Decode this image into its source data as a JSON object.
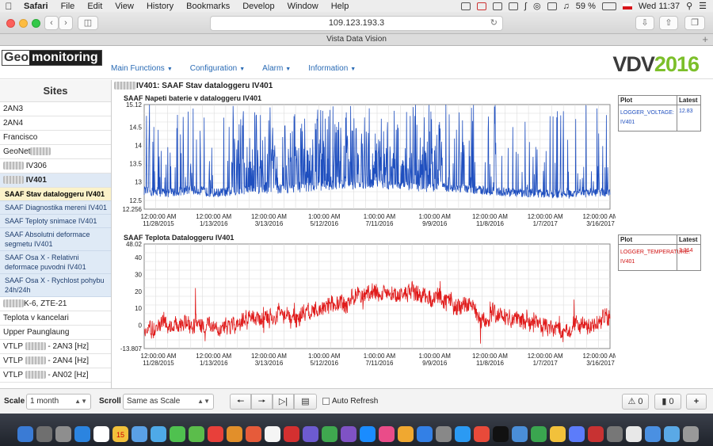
{
  "menubar": {
    "app": "Safari",
    "items": [
      "File",
      "Edit",
      "View",
      "History",
      "Bookmarks",
      "Develop",
      "Window",
      "Help"
    ],
    "battery": "59 %",
    "clock": "Wed 11:37"
  },
  "browser": {
    "url": "109.123.193.3",
    "tab_title": "Vista Data Vision"
  },
  "app": {
    "logo_a": "Geo",
    "logo_b": "monitoring",
    "brand_a": "VDV",
    "brand_b": "2016",
    "nav": [
      "Main Functions",
      "Configuration",
      "Alarm",
      "Information"
    ]
  },
  "sidebar": {
    "title": "Sites",
    "items": [
      {
        "label": "2AN3"
      },
      {
        "label": "2AN4"
      },
      {
        "label": "Francisco"
      },
      {
        "label": "GeoNet"
      },
      {
        "label": "IV306"
      },
      {
        "label": "IV401"
      }
    ],
    "subitems": [
      "SAAF Stav dataloggeru IV401",
      "SAAF Diagnostika mereni IV401",
      "SAAF Teploty snimace IV401",
      "SAAF Absolutni deformace segmetu IV401",
      "SAAF Osa X - Relativni deformace puvodni IV401",
      "SAAF Osa X - Rychlost pohybu 24h/24h"
    ],
    "items_after": [
      "K-6, ZTE-21",
      "Teplota v kancelari",
      "Upper Paunglaung",
      "VTLP",
      "VTLP",
      "VTLP"
    ],
    "vtlp_suffix": [
      "- 2AN3 [Hz]",
      "- 2AN4 [Hz]",
      "- AN02 [Hz]"
    ]
  },
  "main": {
    "page_title": "IV401: SAAF Stav dataloggeru IV401",
    "x_ticks": [
      [
        "12:00:00 AM",
        "11/28/2015"
      ],
      [
        "12:00:00 AM",
        "1/13/2016"
      ],
      [
        "12:00:00 AM",
        "3/13/2016"
      ],
      [
        "1:00:00 AM",
        "5/12/2016"
      ],
      [
        "1:00:00 AM",
        "7/11/2016"
      ],
      [
        "1:00:00 AM",
        "9/9/2016"
      ],
      [
        "12:00:00 AM",
        "11/8/2016"
      ],
      [
        "12:00:00 AM",
        "1/7/2017"
      ],
      [
        "12:00:00 AM",
        "3/16/2017"
      ]
    ]
  },
  "chart_data": [
    {
      "type": "line",
      "title": "SAAF Napeti baterie v dataloggeru IV401",
      "ylim": [
        12.256,
        15.12
      ],
      "y_ticks": [
        "15.12",
        "14.5",
        "14",
        "13.5",
        "13",
        "12.5",
        "12.256"
      ],
      "series": [
        {
          "name": "LOGGER_VOLTAGE: IV401",
          "color": "#1f4fbf",
          "baseline_profile": [
            12.75,
            12.7,
            12.8,
            12.7,
            12.75,
            12.8,
            12.8,
            12.85,
            12.9,
            12.9,
            12.95,
            12.9,
            12.85,
            12.85,
            12.8,
            12.75,
            12.7,
            12.7,
            12.65,
            12.7,
            12.72
          ],
          "spike_max": 15.12
        }
      ],
      "grid": true,
      "legend": {
        "header": [
          "Plot",
          "Latest"
        ],
        "plot": "LOGGER_VOLTAGE: IV401",
        "latest": "12.83"
      }
    },
    {
      "type": "line",
      "title": "SAAF Teplota Dataloggeru IV401",
      "ylim": [
        -13.807,
        48.02
      ],
      "y_ticks": [
        "48.02",
        "40",
        "30",
        "20",
        "10",
        "0",
        "-13.807"
      ],
      "series": [
        {
          "name": "LOGGER_TEMPERATURE: IV401",
          "color": "#e01b1b",
          "profile": [
            0,
            2,
            0,
            -3,
            1,
            4,
            5,
            8,
            12,
            16,
            18,
            19,
            17,
            15,
            10,
            5,
            2,
            1,
            -2,
            0,
            2
          ]
        }
      ],
      "grid": true,
      "legend": {
        "header": [
          "Plot",
          "Latest"
        ],
        "plot": "LOGGER_TEMPERATURE: IV401",
        "latest": "3.314"
      }
    }
  ],
  "bottombar": {
    "scale_label": "Scale",
    "scale_value": "1 month",
    "scroll_label": "Scroll",
    "scroll_value": "Same as Scale",
    "auto_refresh": "Auto Refresh",
    "warn_count": "0",
    "msg_count": "0"
  },
  "dock_date": "15"
}
